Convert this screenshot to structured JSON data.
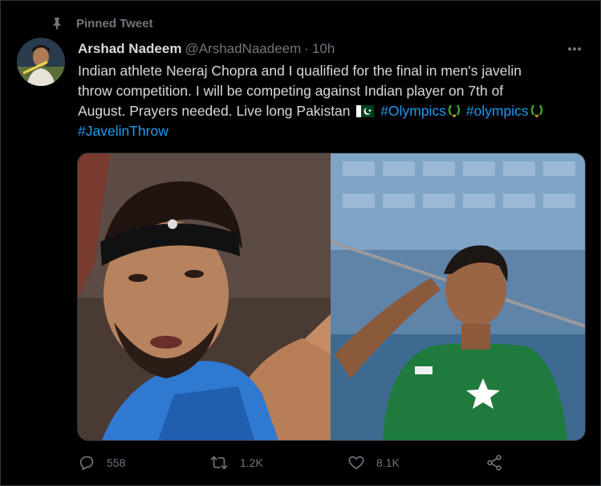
{
  "pinned": {
    "label": "Pinned Tweet"
  },
  "tweet": {
    "author": {
      "name": "Arshad Nadeem",
      "handle": "@ArshadNaadeem",
      "separator": "·",
      "time": "10h"
    },
    "text": {
      "line1": "Indian athlete Neeraj Chopra and I qualified for the final in men's javelin",
      "line2": "throw competition. I will be competing against Indian player on 7th of",
      "line3_start": "August. Prayers needed. Live long Pakistan"
    },
    "hashtags": [
      "#Olympics",
      "#olympics",
      "#JavelinThrow"
    ],
    "counts": {
      "replies": "558",
      "retweets": "1.2K",
      "likes": "8.1K"
    }
  },
  "colors": {
    "background": "#000000",
    "text": "#d9d9d9",
    "muted": "#6e767d",
    "link": "#1d9bf0",
    "border": "#2f3336"
  },
  "icons": [
    "pin-icon",
    "more-icon",
    "pakistan-flag-icon",
    "wreath-icon",
    "reply-icon",
    "retweet-icon",
    "like-icon",
    "share-icon"
  ]
}
